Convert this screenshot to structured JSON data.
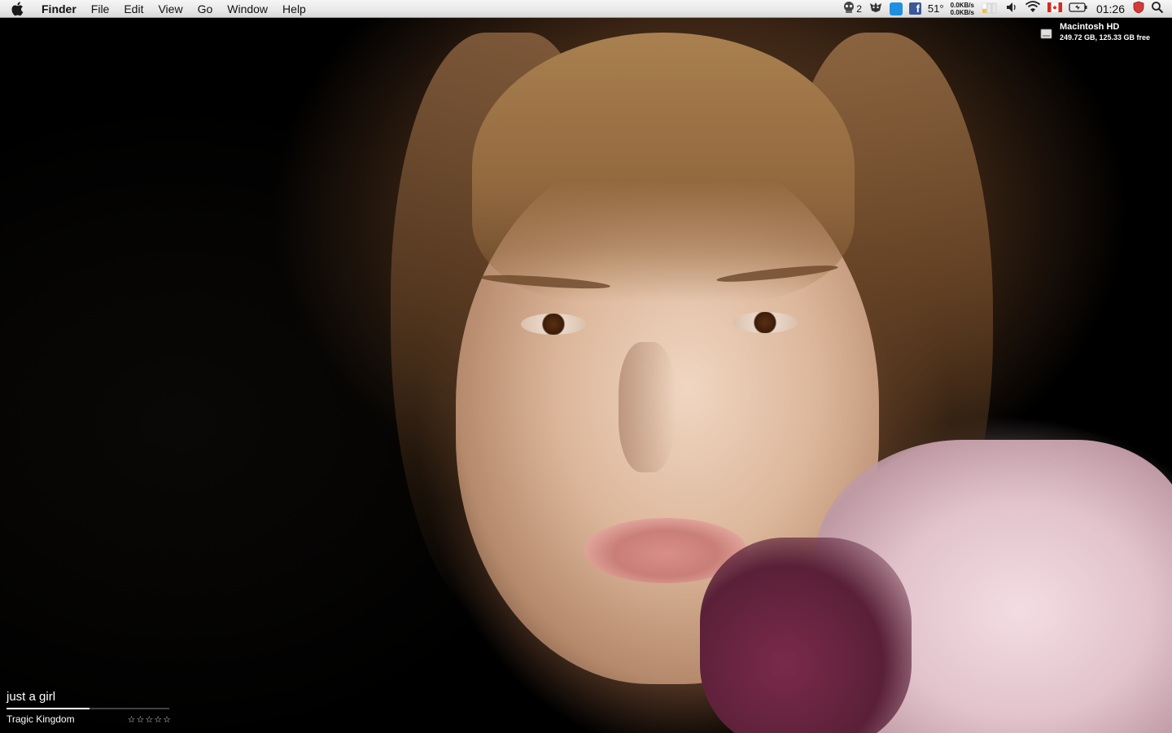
{
  "menubar": {
    "app_name": "Finder",
    "items": [
      "File",
      "Edit",
      "View",
      "Go",
      "Window",
      "Help"
    ],
    "status": {
      "alien_count": "2",
      "weather": "51°",
      "net_up": "0.0KB/s",
      "net_down": "0.0KB/s",
      "clock": "01:26"
    }
  },
  "icons": {
    "apple": "apple-logo-icon",
    "status": [
      "alien-monitor-icon",
      "growl-icon",
      "dropbox-icon",
      "facebook-icon",
      "weather-icon",
      "network-meter-icon",
      "memory-bars-icon",
      "volume-icon",
      "wifi-icon",
      "canada-flag-icon",
      "battery-icon",
      "shield-icon",
      "spotlight-search-icon"
    ]
  },
  "disk": {
    "name": "Macintosh HD",
    "info": "249.72 GB, 125.33 GB free"
  },
  "now_playing": {
    "title": "just a girl",
    "album": "Tragic Kingdom",
    "progress": 0.51,
    "rating_stars": [
      "☆",
      "☆",
      "☆",
      "☆",
      "☆"
    ]
  },
  "colors": {
    "menubar_top": "#f6f6f6",
    "menubar_bottom": "#d9d9d9",
    "widget_text": "#ffffff",
    "facebook_blue": "#3b5998",
    "dropbox_blue": "#1e8fe1",
    "flag_red": "#d52b1e",
    "shield_red": "#d43a3a"
  }
}
